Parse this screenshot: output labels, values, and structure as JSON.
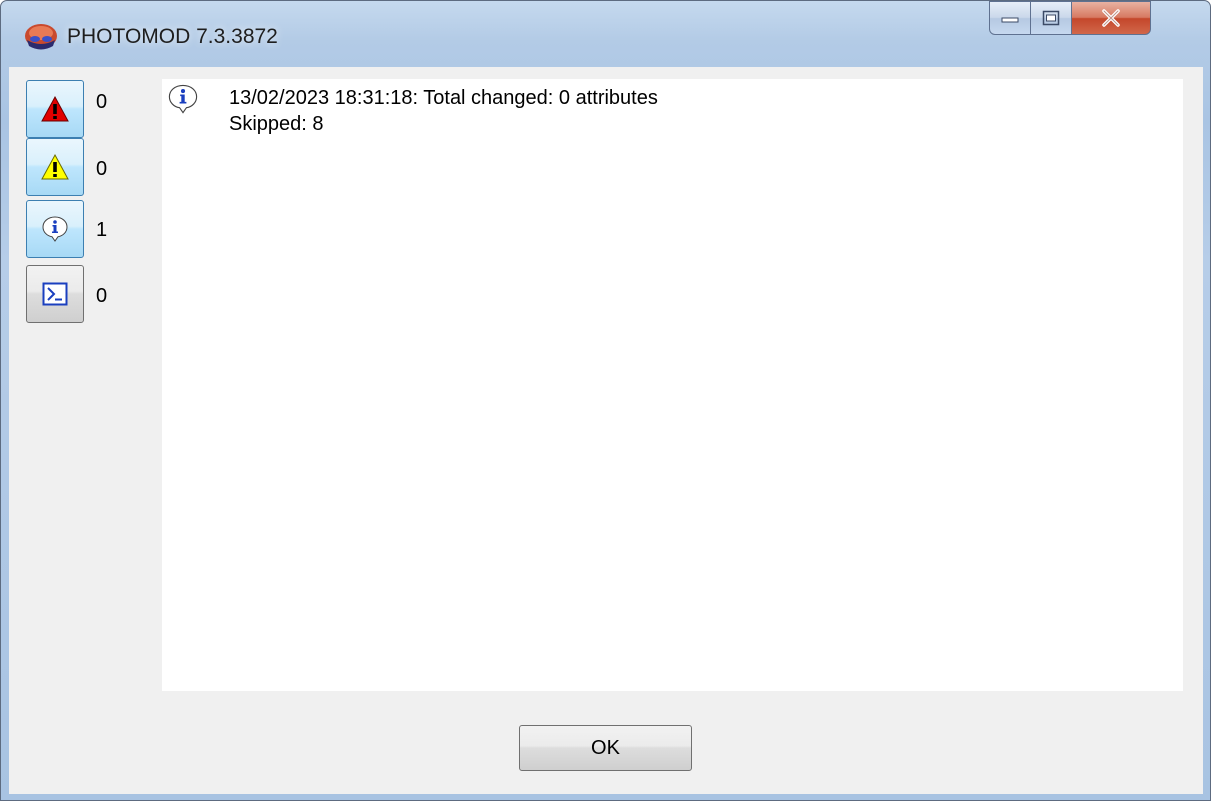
{
  "window": {
    "title": "PHOTOMOD 7.3.3872"
  },
  "sidebar": {
    "filters": [
      {
        "icon": "error-icon",
        "count": "0"
      },
      {
        "icon": "warning-icon",
        "count": "0"
      },
      {
        "icon": "info-icon",
        "count": "1"
      },
      {
        "icon": "console-icon",
        "count": "0"
      }
    ]
  },
  "log": {
    "entries": [
      {
        "icon": "info-icon",
        "line1": "13/02/2023 18:31:18: Total changed: 0 attributes",
        "line2": "Skipped: 8"
      }
    ]
  },
  "footer": {
    "ok_label": "OK"
  },
  "colors": {
    "error": "#e00000",
    "warning": "#ffff00",
    "info": "#1a3fbf",
    "accent": "#3c7fb1"
  }
}
